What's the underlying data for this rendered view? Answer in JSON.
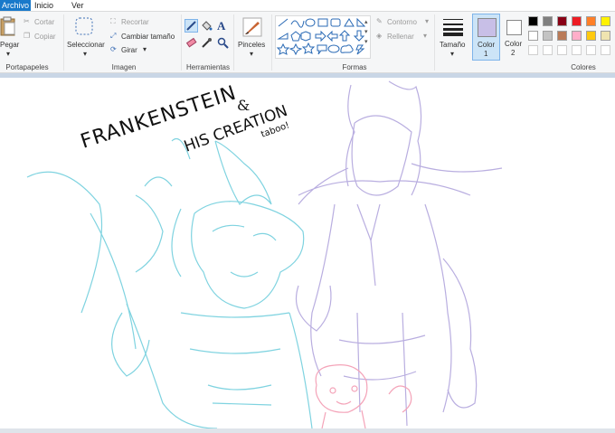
{
  "tabs": [
    {
      "label": "Archivo"
    },
    {
      "label": "Inicio"
    },
    {
      "label": "Ver"
    }
  ],
  "clipboard": {
    "paste_label": "Pegar",
    "cut_label": "Cortar",
    "copy_label": "Copiar",
    "group_label": "Portapapeles"
  },
  "image": {
    "select_label": "Seleccionar",
    "crop_label": "Recortar",
    "resize_label": "Cambiar tamaño",
    "rotate_label": "Girar",
    "group_label": "Imagen"
  },
  "tools": {
    "group_label": "Herramientas"
  },
  "brushes": {
    "label": "Pinceles"
  },
  "shapes": {
    "outline_label": "Contorno",
    "fill_label": "Rellenar",
    "group_label": "Formas"
  },
  "size": {
    "label": "Tamaño"
  },
  "colors": {
    "color1_label": "Color",
    "color1_num": "1",
    "color2_label": "Color",
    "color2_num": "2",
    "group_label": "Colores",
    "palette_row1": [
      "#000000",
      "#7f7f7f",
      "#880015",
      "#ed1c24",
      "#ff7f27",
      "#fff200"
    ],
    "palette_row2": [
      "#ffffff",
      "#c3c3c3",
      "#b97a57",
      "#ffaec9",
      "#ffc90e",
      "#efe4b0"
    ],
    "color1_value": "#c8bfe7",
    "color2_value": "#ffffff"
  },
  "canvas": {
    "title_line1": "FRANKENSTEIN",
    "title_amp": "&",
    "title_line2": "HIS CREATION",
    "signature": "taboo!",
    "stroke_cyan": "#7fd3e0",
    "stroke_lavender": "#b9aee0",
    "stroke_pink": "#f4a3b8"
  }
}
